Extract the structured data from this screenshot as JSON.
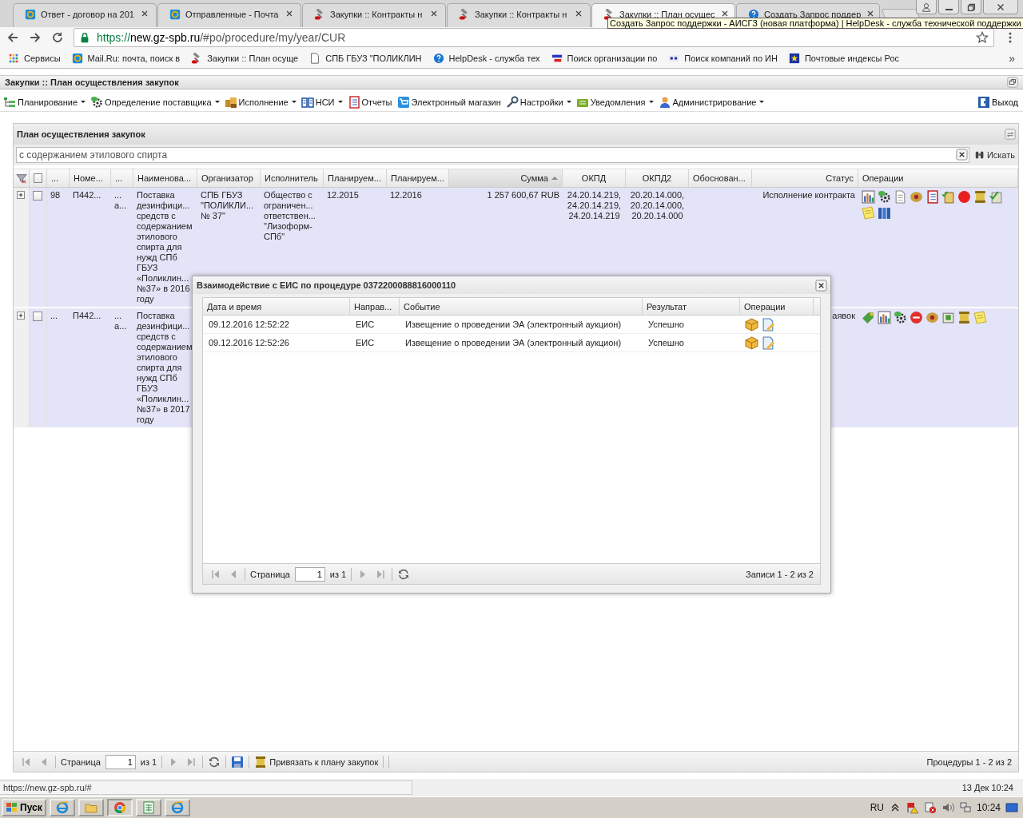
{
  "browser": {
    "tabs": [
      {
        "title": "Ответ - договор на 201",
        "selected": false
      },
      {
        "title": "Отправленные - Почта",
        "selected": false
      },
      {
        "title": "Закупки :: Контракты н",
        "selected": false
      },
      {
        "title": "Закупки :: Контракты н",
        "selected": false
      },
      {
        "title": "Закупки :: План осущес",
        "selected": true
      },
      {
        "title": "Создать Запрос поддер",
        "selected": false
      }
    ],
    "tooltip": "Создать Запрос поддержки - АИСГЗ (новая платформа) | HelpDesk - служба технической поддержки",
    "address": {
      "scheme": "https://",
      "host": "new.gz-spb.ru",
      "path": "/#po/procedure/my/year/CUR"
    },
    "bookmarks": [
      {
        "label": "Сервисы"
      },
      {
        "label": "Mail.Ru: почта, поиск в"
      },
      {
        "label": "Закупки :: План осуще"
      },
      {
        "label": "СПБ ГБУЗ \"ПОЛИКЛИН"
      },
      {
        "label": "HelpDesk - служба тех"
      },
      {
        "label": "Поиск организации по"
      },
      {
        "label": "Поиск компаний по ИН"
      },
      {
        "label": "Почтовые индексы Рос"
      }
    ],
    "bookmarks_more": "»"
  },
  "app": {
    "title": "Закупки :: План осуществления закупок",
    "menu": [
      {
        "label": "Планирование",
        "has_dropdown": true
      },
      {
        "label": "Определение поставщика",
        "has_dropdown": true
      },
      {
        "label": "Исполнение",
        "has_dropdown": true
      },
      {
        "label": "НСИ",
        "has_dropdown": true
      },
      {
        "label": "Отчеты",
        "has_dropdown": false
      },
      {
        "label": "Электронный магазин",
        "has_dropdown": false
      },
      {
        "label": "Настройки",
        "has_dropdown": true
      },
      {
        "label": "Уведомления",
        "has_dropdown": true
      },
      {
        "label": "Администрирование",
        "has_dropdown": true
      }
    ],
    "logout": "Выход"
  },
  "panel": {
    "title": "План осуществления закупок",
    "search": {
      "value": "с содержанием этилового спирта",
      "button": "Искать"
    },
    "all_checked": false,
    "columns": [
      {
        "label": "...",
        "sorted": false
      },
      {
        "label": "Номе...",
        "sorted": false
      },
      {
        "label": "...",
        "sorted": false
      },
      {
        "label": "Наименова...",
        "sorted": false
      },
      {
        "label": "Организатор",
        "sorted": false
      },
      {
        "label": "Исполнитель",
        "sorted": false
      },
      {
        "label": "Планируем...",
        "sorted": false
      },
      {
        "label": "Планируем...",
        "sorted": false
      },
      {
        "label": "Сумма",
        "sorted": true
      },
      {
        "label": "ОКПД",
        "sorted": false
      },
      {
        "label": "ОКПД2",
        "sorted": false
      },
      {
        "label": "Обоснован...",
        "sorted": false
      },
      {
        "label": "Статус",
        "sorted": false
      },
      {
        "label": "Операции",
        "sorted": false
      }
    ],
    "rows": [
      {
        "expanded": false,
        "checked": false,
        "selected": true,
        "column_1": "98",
        "number": "П442...",
        "column_3": "...\nа...",
        "name": "Поставка\nдезинфици...\nсредств с\nсодержанием\nэтилового\nспирта для\nнужд СПб\nГБУЗ\n«Поликлин...\n№37» в 2016\nгоду",
        "organizer": "СПБ ГБУЗ\n\"ПОЛИКЛИ...\n№ 37\"",
        "executor": "Общество с\nограничен...\nответствен...\n\"Лизоформ-\nСПб\"",
        "planned_1": "12.2015",
        "planned_2": "12.2016",
        "sum": "1 257 600,67 RUB",
        "okpd": "24.20.14.219,\n24.20.14.219,\n24.20.14.219",
        "okpd2": "20.20.14.000,\n20.20.14.000,\n20.20.14.000",
        "status": "Исполнение контракта"
      },
      {
        "expanded": false,
        "checked": false,
        "selected": true,
        "column_1": "...",
        "number": "П442...",
        "column_3": "...\nа...",
        "name": "Поставка\nдезинфици...\nсредств с\nсодержанием\nэтилового\nспирта для\nнужд СПб\nГБУЗ\n«Поликлин...\n№37» в 2017\nгоду",
        "status": "аявок"
      }
    ],
    "pager": {
      "page_label": "Страница",
      "page": "1",
      "of": "из 1",
      "action": "Привязать к плану закупок",
      "summary": "Процедуры 1 - 2 из 2"
    }
  },
  "dialog": {
    "title": "Взаимодействие с ЕИС по процедуре 0372200088816000110",
    "columns": [
      "Дата и время",
      "Направ...",
      "Событие",
      "Результат",
      "Операции"
    ],
    "rows": [
      {
        "datetime": "09.12.2016 12:52:22",
        "direction": "ЕИС",
        "event": "Извещение о проведении ЭА (электронный аукцион)",
        "result": "Успешно"
      },
      {
        "datetime": "09.12.2016 12:52:26",
        "direction": "ЕИС",
        "event": "Извещение о проведении ЭА (электронный аукцион)",
        "result": "Успешно"
      }
    ],
    "pager": {
      "page_label": "Страница",
      "page": "1",
      "of": "из 1",
      "summary": "Записи 1 - 2 из 2"
    }
  },
  "status_bar": {
    "url": "https://new.gz-spb.ru/#",
    "datetime": "13 Дек 10:24"
  },
  "taskbar": {
    "start": "Пуск",
    "language": "RU",
    "clock": "10:24"
  }
}
